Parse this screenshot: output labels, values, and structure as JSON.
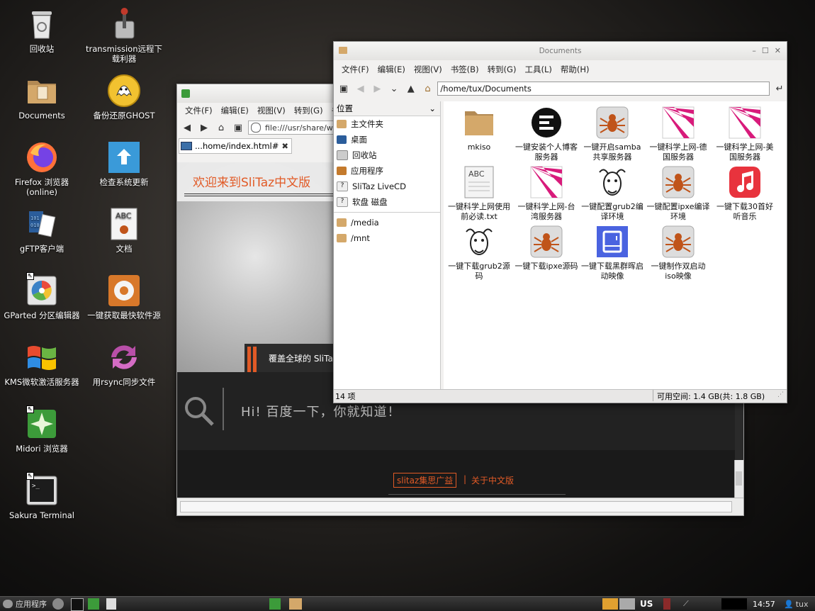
{
  "desktop": {
    "icons": [
      {
        "label": "回收站",
        "icon": "trash-icon"
      },
      {
        "label": "transmission远程下载利器",
        "icon": "transmission-icon"
      },
      {
        "label": "Documents",
        "icon": "folder-icon"
      },
      {
        "label": "备份还原GHOST",
        "icon": "ghost-icon"
      },
      {
        "label": "Firefox 浏览器 (online)",
        "icon": "firefox-icon"
      },
      {
        "label": "检查系统更新",
        "icon": "update-icon"
      },
      {
        "label": "gFTP客户端",
        "icon": "gftp-icon"
      },
      {
        "label": "文档",
        "icon": "document-icon"
      },
      {
        "label": "GParted 分区编辑器",
        "icon": "gparted-icon"
      },
      {
        "label": "一键获取最快软件源",
        "icon": "package-icon"
      },
      {
        "label": "KMS微软激活服务器",
        "icon": "windows-icon"
      },
      {
        "label": "用rsync同步文件",
        "icon": "rsync-icon"
      },
      {
        "label": "Midori 浏览器",
        "icon": "midori-icon"
      },
      {
        "label": "Sakura Terminal",
        "icon": "terminal-icon"
      }
    ]
  },
  "browser": {
    "menu": [
      "文件(F)",
      "编辑(E)",
      "视图(V)",
      "转到(G)",
      "书"
    ],
    "url": "file:///usr/share/we",
    "tab_label": "...home/index.html#",
    "welcome": "欢迎来到SliTaz中文版",
    "banner": "覆盖全球的 SliTa",
    "search_text": "Hi! 百度一下，你就知道！",
    "footer_link1": "slitaz集思广益",
    "footer_sep": "|",
    "footer_link2": "关于中文版"
  },
  "filemanager": {
    "title": "Documents",
    "menu": [
      "文件(F)",
      "编辑(E)",
      "视图(V)",
      "书签(B)",
      "转到(G)",
      "工具(L)",
      "帮助(H)"
    ],
    "path": "/home/tux/Documents",
    "side_header": "位置",
    "places": [
      {
        "label": "主文件夹",
        "icon": "home-icon"
      },
      {
        "label": "桌面",
        "icon": "desktop-icon"
      },
      {
        "label": "回收站",
        "icon": "trash-icon"
      },
      {
        "label": "应用程序",
        "icon": "applications-icon"
      },
      {
        "label": "SliTaz LiveCD",
        "icon": "question-icon"
      },
      {
        "label": "软盘 磁盘",
        "icon": "question-icon"
      }
    ],
    "mounts": [
      {
        "label": "/media",
        "icon": "folder-icon"
      },
      {
        "label": "/mnt",
        "icon": "folder-icon"
      }
    ],
    "files": [
      {
        "label": "mkiso",
        "icon": "folder-icon"
      },
      {
        "label": "一键安装个人博客服务器",
        "icon": "blog-icon"
      },
      {
        "label": "一键开启samba共享服务器",
        "icon": "spider-icon"
      },
      {
        "label": "一键科学上网-德国服务器",
        "icon": "ray-icon"
      },
      {
        "label": "一键科学上网-美国服务器",
        "icon": "ray-icon"
      },
      {
        "label": "一键科学上网使用前必读.txt",
        "icon": "text-file-icon"
      },
      {
        "label": "一键科学上网-台湾服务器",
        "icon": "ray-icon"
      },
      {
        "label": "一键配置grub2编译环境",
        "icon": "gnu-icon"
      },
      {
        "label": "一键配置ipxe编译环境",
        "icon": "spider-icon"
      },
      {
        "label": "一键下载30首好听音乐",
        "icon": "music-icon"
      },
      {
        "label": "一键下载grub2源码",
        "icon": "gnu-icon"
      },
      {
        "label": "一键下载ipxe源码",
        "icon": "spider-icon"
      },
      {
        "label": "一键下载黑群晖启动映像",
        "icon": "nas-icon"
      },
      {
        "label": "一键制作双启动iso映像",
        "icon": "spider-icon"
      }
    ],
    "status_count": "14 项",
    "status_space": "可用空间: 1.4 GB(共: 1.8 GB)"
  },
  "taskbar": {
    "start_label": "应用程序",
    "keyboard_layout": "US",
    "clock": "14:57",
    "user": "tux"
  }
}
